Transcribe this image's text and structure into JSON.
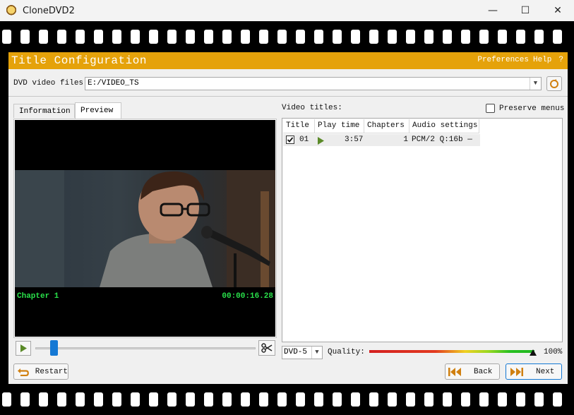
{
  "window": {
    "title": "CloneDVD2",
    "minimize": "—",
    "maximize": "☐",
    "close": "✕"
  },
  "header": {
    "title": "Title Configuration",
    "preferences": "Preferences",
    "help": "Help",
    "question": "?"
  },
  "source": {
    "label": "DVD video files:",
    "value": "E:/VIDEO_TS"
  },
  "tabs": [
    {
      "label": "Information",
      "active": false
    },
    {
      "label": "Preview",
      "active": true
    }
  ],
  "preview": {
    "chapter": "Chapter 1",
    "timecode": "00:00:16.28",
    "position_fraction": 0.07
  },
  "titles": {
    "label": "Video titles:",
    "preserve_menus_label": "Preserve menus",
    "preserve_menus_checked": false,
    "columns": [
      "Title",
      "Play time",
      "Chapters",
      "Audio settings"
    ],
    "rows": [
      {
        "checked": true,
        "title": "01",
        "play_time": "3:57",
        "chapters": "1",
        "audio": "PCM/2 Q:16b —"
      }
    ]
  },
  "output": {
    "media": "DVD-5",
    "quality_label": "Quality:",
    "quality_value": "100%",
    "quality_fraction": 1.0
  },
  "buttons": {
    "restart": "Restart",
    "back": "Back",
    "next": "Next"
  },
  "colors": {
    "header_bg": "#e5a20a",
    "osd_text": "#29e04a",
    "accent": "#1478d4"
  }
}
